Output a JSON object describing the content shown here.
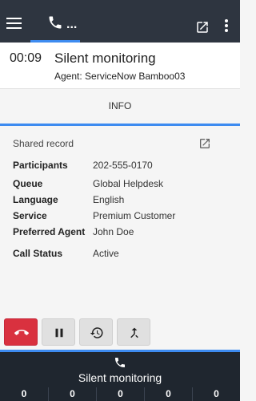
{
  "header": {
    "tab_dots": "...",
    "icons": [
      "menu-icon",
      "phone-icon",
      "open-in-new-icon",
      "more-vert-icon"
    ]
  },
  "call": {
    "timer": "00:09",
    "title": "Silent monitoring",
    "agent": "Agent: ServiceNow Bamboo03"
  },
  "tabs": {
    "info_label": "INFO"
  },
  "details": {
    "shared_label": "Shared record",
    "fields": [
      {
        "key": "Participants",
        "value": "202-555-0170"
      },
      {
        "key": "Queue",
        "value": "Global Helpdesk"
      },
      {
        "key": "Language",
        "value": "English"
      },
      {
        "key": "Service",
        "value": "Premium Customer"
      },
      {
        "key": "Preferred Agent",
        "value": "John Doe"
      },
      {
        "key": "Call Status",
        "value": "Active"
      }
    ]
  },
  "controls": [
    "hang-up",
    "pause",
    "history",
    "merge"
  ],
  "bottom": {
    "title": "Silent monitoring",
    "counters": [
      "0",
      "0",
      "0",
      "0",
      "0"
    ]
  },
  "colors": {
    "topbar": "#2e3540",
    "accent": "#3d8bf0",
    "hangup": "#d9313f",
    "bottom": "#1f262f"
  }
}
